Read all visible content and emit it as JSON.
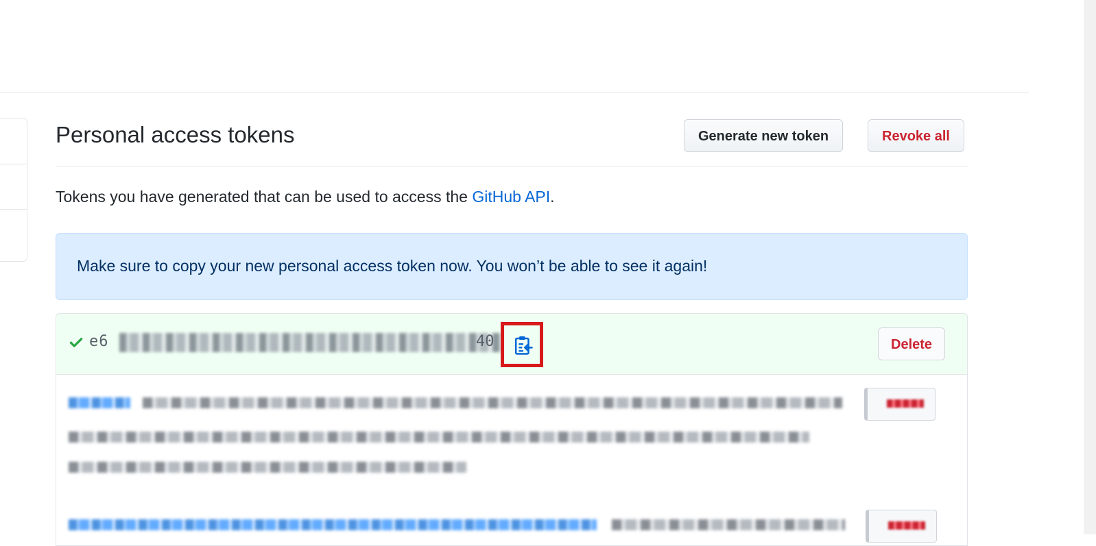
{
  "page": {
    "title": "Personal access tokens",
    "description_prefix": "Tokens you have generated that can be used to access the ",
    "description_link": "GitHub API",
    "description_suffix": "."
  },
  "header": {
    "generate_label": "Generate new token",
    "revoke_label": "Revoke all"
  },
  "flash": {
    "message": "Make sure to copy your new personal access token now. You won’t be able to see it again!"
  },
  "new_token": {
    "value_prefix": "e6",
    "value_suffix": "40",
    "delete_label": "Delete"
  },
  "colors": {
    "link": "#0366d6",
    "danger": "#cb2431",
    "success": "#28a745",
    "flash_bg": "#dbedff",
    "token_bg": "#f0fff4",
    "highlight_box": "#d7191c"
  }
}
